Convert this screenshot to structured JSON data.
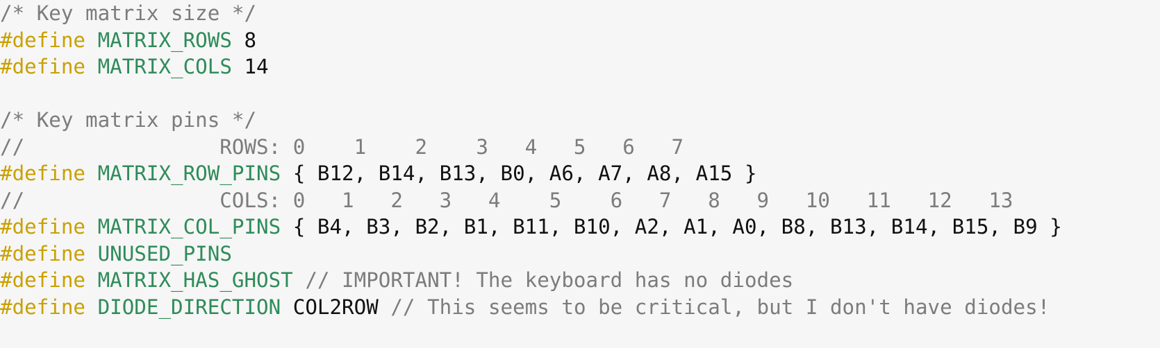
{
  "code": {
    "line_1": {
      "comment": "/* Key matrix size */"
    },
    "line_2": {
      "keyword": "#define",
      "macro": "MATRIX_ROWS",
      "value": "8"
    },
    "line_3": {
      "keyword": "#define",
      "macro": "MATRIX_COLS",
      "value": "14"
    },
    "line_4": {
      "text": ""
    },
    "line_5": {
      "comment": "/* Key matrix pins */"
    },
    "line_6": {
      "comment": "//                ROWS: 0    1    2    3   4   5   6   7"
    },
    "line_7": {
      "keyword": "#define",
      "macro": "MATRIX_ROW_PINS",
      "value": "{ B12, B14, B13, B0, A6, A7, A8, A15 }"
    },
    "line_8": {
      "comment": "//                COLS: 0   1   2   3   4    5    6   7   8   9   10   11   12   13"
    },
    "line_9": {
      "keyword": "#define",
      "macro": "MATRIX_COL_PINS",
      "value": "{ B4, B3, B2, B1, B11, B10, A2, A1, A0, B8, B13, B14, B15, B9 }"
    },
    "line_10": {
      "keyword": "#define",
      "macro": "UNUSED_PINS"
    },
    "line_11": {
      "keyword": "#define",
      "macro": "MATRIX_HAS_GHOST",
      "comment": "// IMPORTANT! The keyboard has no diodes"
    },
    "line_12": {
      "keyword": "#define",
      "macro": "DIODE_DIRECTION",
      "value": "COL2ROW",
      "comment": "// This seems to be critical, but I don't have diodes!"
    }
  }
}
